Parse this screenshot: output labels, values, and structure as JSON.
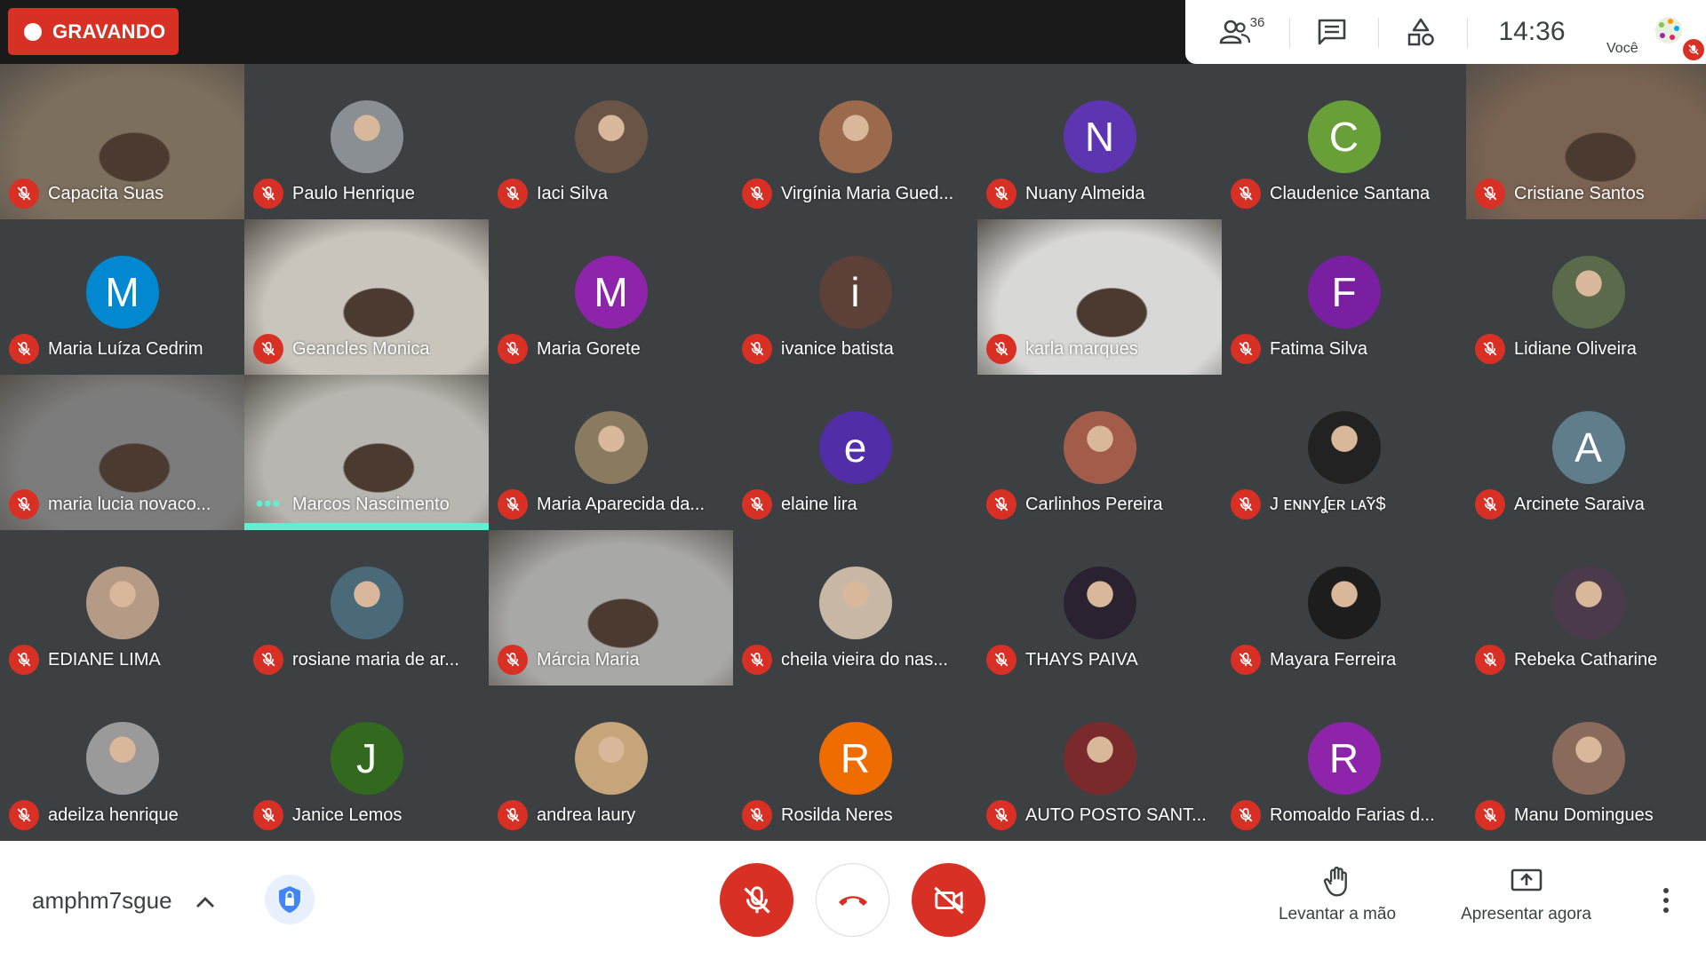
{
  "recording": {
    "label": "GRAVANDO"
  },
  "top_panel": {
    "participant_count": "36",
    "time": "14:36",
    "self_label": "Você"
  },
  "participants": [
    {
      "name": "Capacita Suas",
      "kind": "video",
      "bg": "#7d6f5e"
    },
    {
      "name": "Paulo Henrique",
      "kind": "photo",
      "bg": "#8a8f94"
    },
    {
      "name": "Iaci Silva",
      "kind": "photo",
      "bg": "#6a5446"
    },
    {
      "name": "Virgínia Maria Gued...",
      "kind": "photo",
      "bg": "#9b6a4c"
    },
    {
      "name": "Nuany Almeida",
      "kind": "initial",
      "initial": "N",
      "bg": "#5e35b1"
    },
    {
      "name": "Claudenice Santana",
      "kind": "initial",
      "initial": "C",
      "bg": "#689f38"
    },
    {
      "name": "Cristiane Santos",
      "kind": "video",
      "bg": "#7a6352"
    },
    {
      "name": "Maria Luíza Cedrim",
      "kind": "initial",
      "initial": "M",
      "bg": "#0288d1"
    },
    {
      "name": "Geancles Monica",
      "kind": "video",
      "bg": "#c9c5bd"
    },
    {
      "name": "Maria Gorete",
      "kind": "initial",
      "initial": "M",
      "bg": "#8e24aa"
    },
    {
      "name": "ivanice batista",
      "kind": "initial",
      "initial": "i",
      "bg": "#5d4037"
    },
    {
      "name": "karla marques",
      "kind": "video",
      "bg": "#d8d8d6"
    },
    {
      "name": "Fatima Silva",
      "kind": "initial",
      "initial": "F",
      "bg": "#7b1fa2"
    },
    {
      "name": "Lidiane Oliveira",
      "kind": "photo",
      "bg": "#5a6a4a"
    },
    {
      "name": "maria lucia novaco...",
      "kind": "video",
      "bg": "#7c7c7c"
    },
    {
      "name": "Marcos Nascimento",
      "kind": "video-speaking",
      "bg": "#b8b6b0"
    },
    {
      "name": "Maria Aparecida da...",
      "kind": "photo",
      "bg": "#8a7b60"
    },
    {
      "name": "elaine lira",
      "kind": "initial",
      "initial": "e",
      "bg": "#512da8"
    },
    {
      "name": "Carlinhos Pereira",
      "kind": "photo",
      "bg": "#a35c4a"
    },
    {
      "name": "J ᴇɴɴʏʆᴇʀ ʟᴀ̃ʏ$",
      "kind": "photo",
      "bg": "#222222"
    },
    {
      "name": "Arcinete Saraiva",
      "kind": "initial",
      "initial": "A",
      "bg": "#607d8b"
    },
    {
      "name": "EDIANE LIMA",
      "kind": "photo",
      "bg": "#b59a86"
    },
    {
      "name": "rosiane maria de ar...",
      "kind": "photo",
      "bg": "#4a6a7a"
    },
    {
      "name": "Márcia Maria",
      "kind": "video",
      "bg": "#a8a8a6"
    },
    {
      "name": "cheila vieira do nas...",
      "kind": "photo",
      "bg": "#c9b7a6"
    },
    {
      "name": "THAYS PAIVA",
      "kind": "photo",
      "bg": "#2a2230"
    },
    {
      "name": "Mayara Ferreira",
      "kind": "photo",
      "bg": "#1d1d1d"
    },
    {
      "name": "Rebeka Catharine",
      "kind": "photo",
      "bg": "#4a3a4a"
    },
    {
      "name": "adeilza henrique",
      "kind": "photo",
      "bg": "#9a9a9a"
    },
    {
      "name": "Janice Lemos",
      "kind": "initial",
      "initial": "J",
      "bg": "#33691e"
    },
    {
      "name": "andrea laury",
      "kind": "photo",
      "bg": "#c7a57a"
    },
    {
      "name": "Rosilda Neres",
      "kind": "initial",
      "initial": "R",
      "bg": "#ef6c00"
    },
    {
      "name": "AUTO POSTO SANT...",
      "kind": "photo",
      "bg": "#7a2a2a"
    },
    {
      "name": "Romoaldo Farias d...",
      "kind": "initial",
      "initial": "R",
      "bg": "#8e24aa"
    },
    {
      "name": "Manu Domingues",
      "kind": "photo",
      "bg": "#8a6a5a"
    }
  ],
  "bottom": {
    "meeting_code": "amphm7sgue",
    "raise_hand_label": "Levantar a mão",
    "present_label": "Apresentar agora"
  },
  "colors": {
    "red": "#d93025",
    "speaking": "#5ff0d3",
    "tile_bg": "#3c4043"
  }
}
